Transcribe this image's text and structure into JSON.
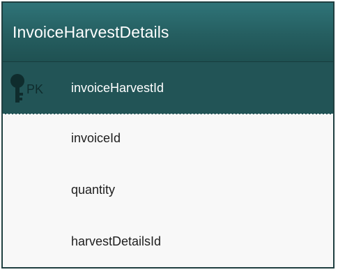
{
  "entity": {
    "title": "InvoiceHarvestDetails",
    "primary_key": {
      "badge": "PK",
      "name": "invoiceHarvestId",
      "icon": "key-icon"
    },
    "fields": [
      {
        "name": "invoiceId"
      },
      {
        "name": "quantity"
      },
      {
        "name": "harvestDetailsId"
      }
    ]
  },
  "colors": {
    "header_top": "#2f7478",
    "header_bottom": "#1f5152",
    "pk_row": "#225456",
    "body": "#f8f8f8",
    "border": "#1f3f40"
  }
}
